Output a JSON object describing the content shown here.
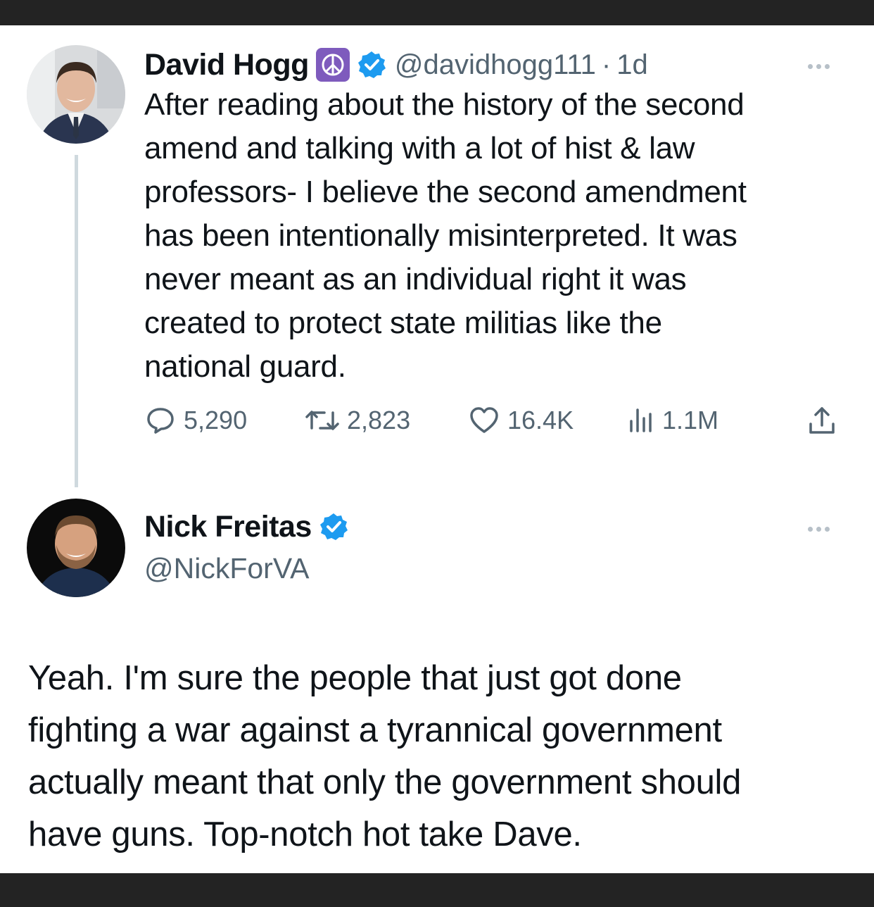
{
  "tweet1": {
    "display_name": "David Hogg",
    "handle": "@davidhogg111",
    "separator": "·",
    "time": "1d",
    "text_lines": [
      "After reading  about the history of the second",
      "amend and talking with a lot of hist & law",
      "professors- I believe the second amendment",
      "has been intentionally misinterpreted. It was",
      "never meant as an individual right it was",
      "created to protect state militias like the",
      "national guard."
    ],
    "stats": {
      "replies": "5,290",
      "retweets": "2,823",
      "likes": "16.4K",
      "views": "1.1M"
    },
    "icons": {
      "name_badge": "peace-sign-icon",
      "verified": "verified-badge-icon",
      "reply": "reply-icon",
      "retweet": "retweet-icon",
      "like": "heart-icon",
      "views": "views-bar-chart-icon",
      "share": "share-icon",
      "more": "more-dots-icon"
    }
  },
  "tweet2": {
    "display_name": "Nick Freitas",
    "handle": "@NickForVA",
    "text_lines": [
      "Yeah. I'm sure the people that just got done",
      "fighting a war against a tyrannical government",
      "actually meant that only the government should",
      "have guns. Top-notch hot take Dave."
    ],
    "icons": {
      "verified": "verified-badge-icon",
      "more": "more-dots-icon"
    }
  },
  "colors": {
    "text": "#0f1419",
    "secondary_text": "#536471",
    "verified_blue": "#1d9bf0",
    "peace_badge": "#7e5bbd",
    "frame": "#232323",
    "thread_line": "#cfd9de"
  }
}
